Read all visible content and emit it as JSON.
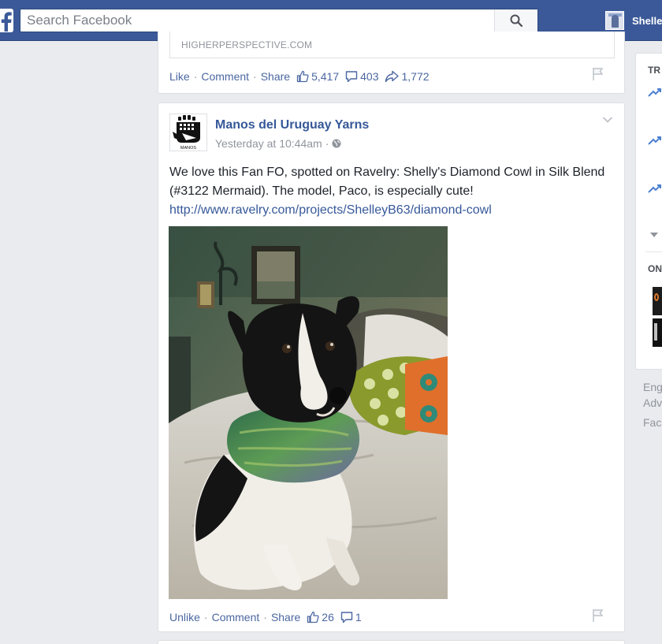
{
  "topbar": {
    "logo": "facebook-logo",
    "search_placeholder": "Search Facebook",
    "search_icon": "search-icon",
    "user_name": "Shelle"
  },
  "previous_post": {
    "link_domain": "HIGHERPERSPECTIVE.COM",
    "like_label": "Like",
    "comment_label": "Comment",
    "share_label": "Share",
    "likes": "5,417",
    "comments": "403",
    "shares": "1,772"
  },
  "post": {
    "page_name": "Manos del Uruguay Yarns",
    "timestamp": "Yesterday at 10:44am",
    "privacy_icon": "globe-icon",
    "text": "We love this Fan FO, spotted on Ravelry: Shelly's Diamond Cowl in Silk Blend (#3122 Mermaid). The model, Paco, is especially cute!",
    "link": "http://www.ravelry.com/projects/ShelleyB63/diamond-cowl",
    "logo_text": "MANOS",
    "unlike_label": "Unlike",
    "comment_label": "Comment",
    "share_label": "Share",
    "likes": "26",
    "comments": "1"
  },
  "right_column": {
    "trending_heading": "TR",
    "online_heading": "ON",
    "footer": [
      "Eng",
      "Adv",
      "Fac"
    ]
  },
  "colors": {
    "brand_blue": "#3b5998",
    "link_blue": "#365899",
    "muted_gray": "#90949c",
    "page_bg": "#e9ebee"
  }
}
